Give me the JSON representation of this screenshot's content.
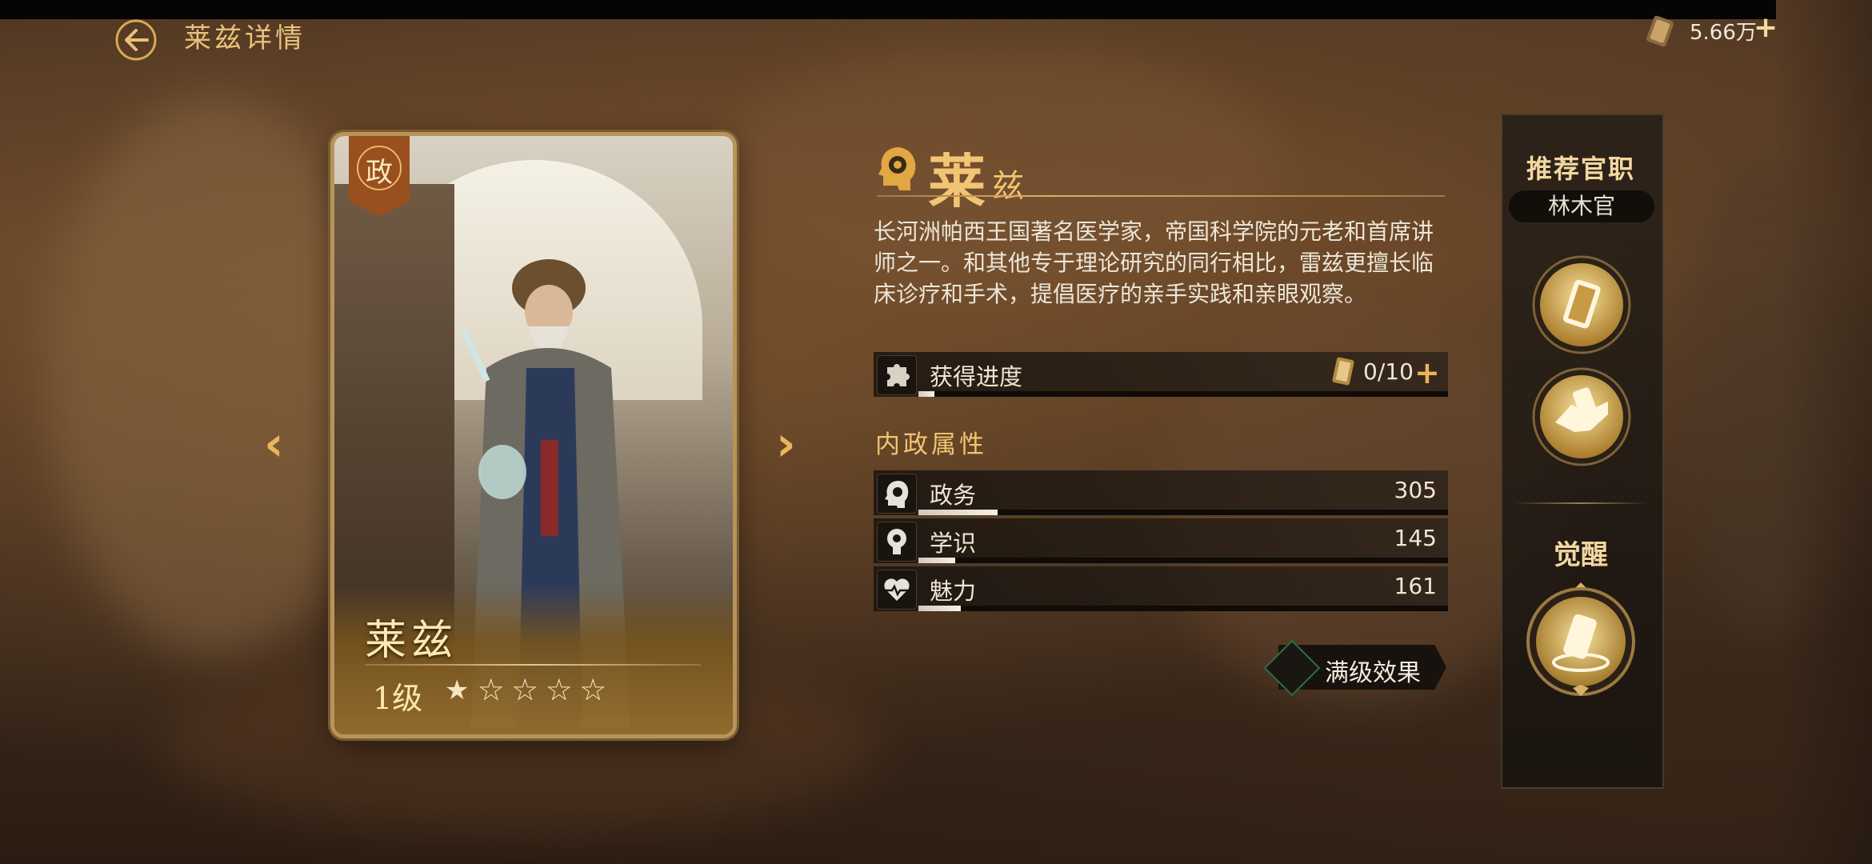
{
  "header": {
    "title": "莱兹详情",
    "resource": {
      "icon": "scroll-icon",
      "value": "5.66万",
      "add": "+"
    }
  },
  "card": {
    "type_badge": "政",
    "name": "莱兹",
    "level": "1级",
    "stars": {
      "filled": 1,
      "total": 5
    }
  },
  "hero": {
    "name_main": "莱",
    "name_sub": "兹",
    "description": "长河洲帕西王国著名医学家，帝国科学院的元老和首席讲师之一。和其他专于理论研究的同行相比，雷兹更擅长临床诊疗和手术，提倡医疗的亲手实践和亲眼观察。",
    "progress": {
      "label": "获得进度",
      "value": "0/10",
      "current": 0,
      "max": 10,
      "plus": "+"
    },
    "section_title": "内政属性",
    "attributes": [
      {
        "label": "政务",
        "value": "305",
        "level": 0.15,
        "icon": "brain-gear-icon"
      },
      {
        "label": "学识",
        "value": "145",
        "level": 0.07,
        "icon": "lightbulb-brain-icon"
      },
      {
        "label": "魅力",
        "value": "161",
        "level": 0.08,
        "icon": "heart-pulse-icon"
      }
    ],
    "full_level_button": "满级效果"
  },
  "sidebar": {
    "title": "推荐官职",
    "position": "林木官",
    "awaken": "觉醒"
  },
  "colors": {
    "accent": "#f2c473",
    "panel": "#1c1712",
    "green": "#2f6e45"
  }
}
